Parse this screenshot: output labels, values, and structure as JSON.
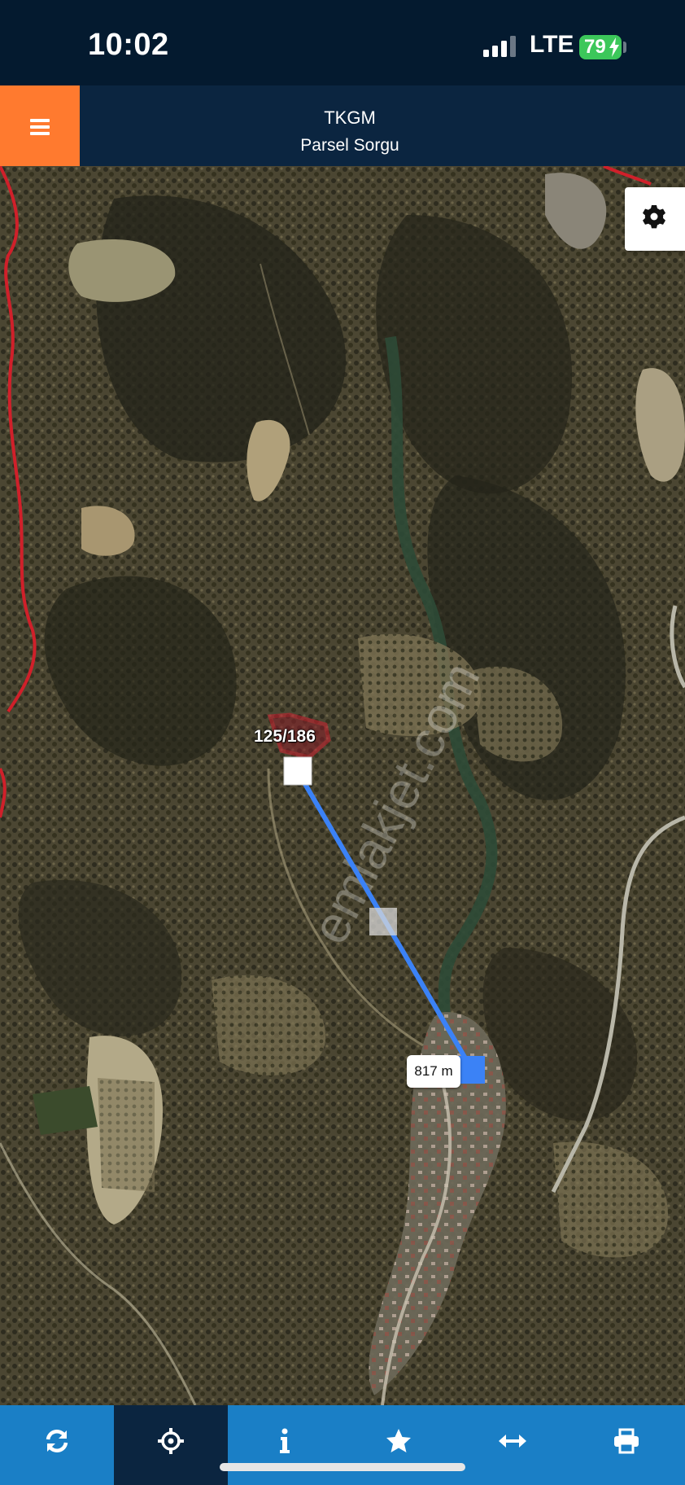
{
  "status_bar": {
    "time": "10:02",
    "network": "LTE",
    "battery": "79",
    "icons": [
      "signal-icon",
      "battery-icon",
      "charging-bolt-icon"
    ]
  },
  "header": {
    "title": "TKGM",
    "subtitle": "Parsel Sorgu",
    "menu_icon": "hamburger-menu-icon"
  },
  "map": {
    "parcel_label": "125/186",
    "distance_label": "817 m",
    "settings_icon": "gear-icon",
    "line_color": "#3b82f6",
    "parcel_border_color": "#cc1f2f",
    "watermark": "emlakjet.com"
  },
  "toolbar": {
    "items": [
      {
        "icon": "refresh-icon",
        "active": false
      },
      {
        "icon": "locate-crosshair-icon",
        "active": true
      },
      {
        "icon": "info-icon",
        "active": false
      },
      {
        "icon": "star-icon",
        "active": false
      },
      {
        "icon": "measure-arrows-icon",
        "active": false
      },
      {
        "icon": "print-icon",
        "active": false
      }
    ],
    "color": "#1a7fc6",
    "active_color": "#0b2540"
  }
}
